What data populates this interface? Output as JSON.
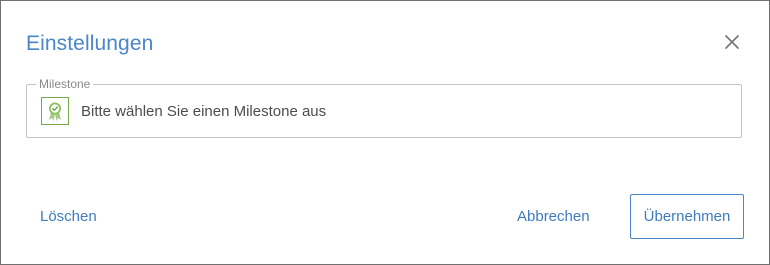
{
  "dialog": {
    "title": "Einstellungen",
    "close_icon": "close-icon",
    "milestone_field": {
      "legend": "Milestone",
      "placeholder": "Bitte wählen Sie einen Milestone aus",
      "icon": "milestone-award-icon"
    },
    "buttons": {
      "delete_label": "Löschen",
      "cancel_label": "Abbrechen",
      "apply_label": "Übernehmen"
    }
  },
  "colors": {
    "accent": "#4a86c8",
    "milestone_icon": "#77a84a",
    "border": "#c4c4c4"
  }
}
